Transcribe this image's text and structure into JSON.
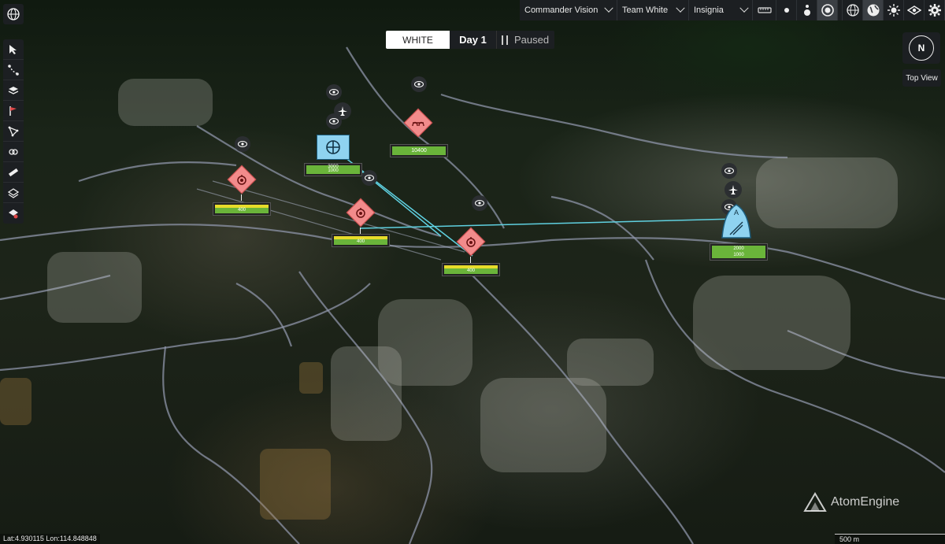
{
  "toolbar": {
    "vision_mode": "Commander Vision",
    "team_select": "Team White",
    "display_select": "Insignia",
    "icons": [
      "ruler-icon",
      "point-icon",
      "pin-icon",
      "target-icon",
      "globe-icon",
      "globe-filled-icon",
      "sun-icon",
      "eye-icon",
      "gear-icon"
    ],
    "active_icons": [
      "target-icon",
      "globe-filled-icon"
    ]
  },
  "left_tools": [
    "select-icon",
    "path-icon",
    "layers-icon",
    "flag-icon",
    "polygon-icon",
    "link-icon",
    "measure-icon",
    "terrain-icon",
    "settings-icon"
  ],
  "time_panel": {
    "team": "WHITE",
    "day": "Day 1",
    "status": "Paused"
  },
  "compass": {
    "label": "N",
    "view_button": "Top View"
  },
  "units": {
    "friendly_radar": {
      "values": [
        "3000",
        "1000"
      ]
    },
    "friendly_airbase": {
      "values": [
        "2000",
        "1000"
      ]
    },
    "hostile_1": {
      "value": "400"
    },
    "hostile_2": {
      "value": "400"
    },
    "hostile_3": {
      "value": "400"
    },
    "hostile_4": {
      "value": "10400"
    }
  },
  "footer": {
    "coordinates": "Lat:4.930115 Lon:114.848848",
    "scale": "500 m",
    "brand": "AtomEngine"
  },
  "colors": {
    "friendly": "#8fd3f0",
    "hostile": "#f28b8b",
    "link_line": "#5fd0e0",
    "health": "#6ab43a",
    "fuel": "#e7dc2a"
  }
}
